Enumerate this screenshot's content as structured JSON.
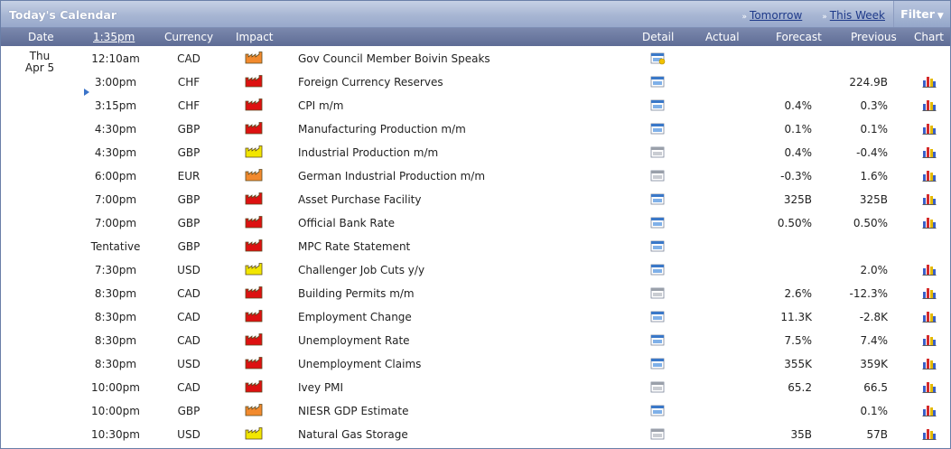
{
  "title": "Today's Calendar",
  "nav": {
    "tomorrow": "Tomorrow",
    "this_week": "This Week",
    "filter": "Filter"
  },
  "colors": {
    "high": "#dd1111",
    "medium": "#f28a2e",
    "low": "#f2e600",
    "header_bg": "#6b78a0"
  },
  "columns": {
    "date": "Date",
    "time": "1:35pm",
    "currency": "Currency",
    "impact": "Impact",
    "detail": "Detail",
    "actual": "Actual",
    "forecast": "Forecast",
    "previous": "Previous",
    "chart": "Chart"
  },
  "day": {
    "weekday": "Thu",
    "date": "Apr 5"
  },
  "events": [
    {
      "time": "12:10am",
      "currency": "CAD",
      "impact": "medium",
      "event": "Gov Council Member Boivin Speaks",
      "detail": "detail-speech-icon",
      "actual": "",
      "forecast": "",
      "previous": "",
      "chart": false
    },
    {
      "time": "3:00pm",
      "currency": "CHF",
      "impact": "high",
      "event": "Foreign Currency Reserves",
      "detail": "detail-blue-icon",
      "actual": "",
      "forecast": "",
      "previous": "224.9B",
      "chart": true,
      "current": true
    },
    {
      "time": "3:15pm",
      "currency": "CHF",
      "impact": "high",
      "event": "CPI m/m",
      "detail": "detail-blue-icon",
      "actual": "",
      "forecast": "0.4%",
      "previous": "0.3%",
      "chart": true
    },
    {
      "time": "4:30pm",
      "currency": "GBP",
      "impact": "high",
      "event": "Manufacturing Production m/m",
      "detail": "detail-blue-icon",
      "actual": "",
      "forecast": "0.1%",
      "previous": "0.1%",
      "chart": true
    },
    {
      "time": "4:30pm",
      "currency": "GBP",
      "impact": "low",
      "event": "Industrial Production m/m",
      "detail": "detail-gray-icon",
      "actual": "",
      "forecast": "0.4%",
      "previous": "-0.4%",
      "chart": true
    },
    {
      "time": "6:00pm",
      "currency": "EUR",
      "impact": "medium",
      "event": "German Industrial Production m/m",
      "detail": "detail-gray-icon",
      "actual": "",
      "forecast": "-0.3%",
      "previous": "1.6%",
      "chart": true
    },
    {
      "time": "7:00pm",
      "currency": "GBP",
      "impact": "high",
      "event": "Asset Purchase Facility",
      "detail": "detail-blue-icon",
      "actual": "",
      "forecast": "325B",
      "previous": "325B",
      "chart": true
    },
    {
      "time": "7:00pm",
      "currency": "GBP",
      "impact": "high",
      "event": "Official Bank Rate",
      "detail": "detail-blue-icon",
      "actual": "",
      "forecast": "0.50%",
      "previous": "0.50%",
      "chart": true
    },
    {
      "time": "Tentative",
      "currency": "GBP",
      "impact": "high",
      "event": "MPC Rate Statement",
      "detail": "detail-blue-icon",
      "actual": "",
      "forecast": "",
      "previous": "",
      "chart": false
    },
    {
      "time": "7:30pm",
      "currency": "USD",
      "impact": "low",
      "event": "Challenger Job Cuts y/y",
      "detail": "detail-blue-icon",
      "actual": "",
      "forecast": "",
      "previous": "2.0%",
      "chart": true
    },
    {
      "time": "8:30pm",
      "currency": "CAD",
      "impact": "high",
      "event": "Building Permits m/m",
      "detail": "detail-gray-icon",
      "actual": "",
      "forecast": "2.6%",
      "previous": "-12.3%",
      "chart": true
    },
    {
      "time": "8:30pm",
      "currency": "CAD",
      "impact": "high",
      "event": "Employment Change",
      "detail": "detail-blue-icon",
      "actual": "",
      "forecast": "11.3K",
      "previous": "-2.8K",
      "chart": true
    },
    {
      "time": "8:30pm",
      "currency": "CAD",
      "impact": "high",
      "event": "Unemployment Rate",
      "detail": "detail-blue-icon",
      "actual": "",
      "forecast": "7.5%",
      "previous": "7.4%",
      "chart": true
    },
    {
      "time": "8:30pm",
      "currency": "USD",
      "impact": "high",
      "event": "Unemployment Claims",
      "detail": "detail-blue-icon",
      "actual": "",
      "forecast": "355K",
      "previous": "359K",
      "chart": true
    },
    {
      "time": "10:00pm",
      "currency": "CAD",
      "impact": "high",
      "event": "Ivey PMI",
      "detail": "detail-gray-icon",
      "actual": "",
      "forecast": "65.2",
      "previous": "66.5",
      "chart": true
    },
    {
      "time": "10:00pm",
      "currency": "GBP",
      "impact": "medium",
      "event": "NIESR GDP Estimate",
      "detail": "detail-blue-icon",
      "actual": "",
      "forecast": "",
      "previous": "0.1%",
      "chart": true
    },
    {
      "time": "10:30pm",
      "currency": "USD",
      "impact": "low",
      "event": "Natural Gas Storage",
      "detail": "detail-gray-icon",
      "actual": "",
      "forecast": "35B",
      "previous": "57B",
      "chart": true
    }
  ]
}
